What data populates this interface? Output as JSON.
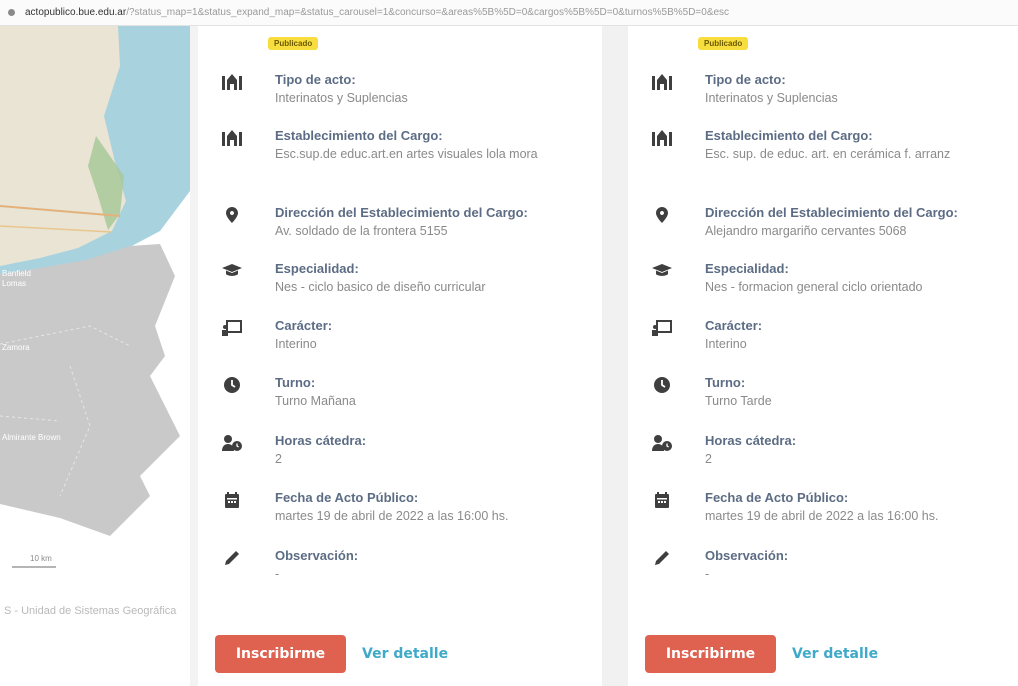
{
  "browser": {
    "url_domain": "actopublico.bue.edu.ar",
    "url_query": "/?status_map=1&status_expand_map=&status_carousel=1&concurso=&areas%5B%5D=0&cargos%5B%5D=0&turnos%5B%5D=0&esc"
  },
  "map": {
    "labels": [
      {
        "text": "Banfield"
      },
      {
        "text": "Lomas"
      },
      {
        "text": "Zamora"
      },
      {
        "text": "Almirante Brown"
      }
    ],
    "scale_label": "10 km",
    "attribution": "S - Unidad de Sistemas Geográfica"
  },
  "cards": [
    {
      "badge": "Publicado",
      "fields": [
        {
          "icon": "building-icon",
          "label": "Tipo de acto:",
          "value": "Interinatos y Suplencias"
        },
        {
          "icon": "building-icon",
          "label": "Establecimiento del Cargo:",
          "value": "Esc.sup.de educ.art.en artes visuales lola mora"
        },
        {
          "icon": "map-marker-icon",
          "label": "Dirección del Establecimiento del Cargo:",
          "value": "Av. soldado de la frontera 5155"
        },
        {
          "icon": "graduation-cap-icon",
          "label": "Especialidad:",
          "value": "Nes - ciclo basico de diseño curricular"
        },
        {
          "icon": "chalkboard-icon",
          "label": "Carácter:",
          "value": "Interino"
        },
        {
          "icon": "clock-icon",
          "label": "Turno:",
          "value": "Turno Mañana"
        },
        {
          "icon": "user-clock-icon",
          "label": "Horas cátedra:",
          "value": "2"
        },
        {
          "icon": "calendar-icon",
          "label": "Fecha de Acto Público:",
          "value": "martes 19 de abril de 2022 a las 16:00 hs."
        },
        {
          "icon": "pencil-icon",
          "label": "Observación:",
          "value": "-"
        }
      ],
      "primary_button": "Inscribirme",
      "secondary_button": "Ver detalle"
    },
    {
      "badge": "Publicado",
      "fields": [
        {
          "icon": "building-icon",
          "label": "Tipo de acto:",
          "value": "Interinatos y Suplencias"
        },
        {
          "icon": "building-icon",
          "label": "Establecimiento del Cargo:",
          "value": "Esc. sup. de educ. art. en cerámica f. arranz"
        },
        {
          "icon": "map-marker-icon",
          "label": "Dirección del Establecimiento del Cargo:",
          "value": "Alejandro margariño cervantes 5068"
        },
        {
          "icon": "graduation-cap-icon",
          "label": "Especialidad:",
          "value": "Nes - formacion general ciclo orientado"
        },
        {
          "icon": "chalkboard-icon",
          "label": "Carácter:",
          "value": "Interino"
        },
        {
          "icon": "clock-icon",
          "label": "Turno:",
          "value": "Turno Tarde"
        },
        {
          "icon": "user-clock-icon",
          "label": "Horas cátedra:",
          "value": "2"
        },
        {
          "icon": "calendar-icon",
          "label": "Fecha de Acto Público:",
          "value": "martes 19 de abril de 2022 a las 16:00 hs."
        },
        {
          "icon": "pencil-icon",
          "label": "Observación:",
          "value": "-"
        }
      ],
      "primary_button": "Inscribirme",
      "secondary_button": "Ver detalle"
    }
  ],
  "colors": {
    "label": "#5c6c84",
    "value": "#8a8a8a",
    "primary_button": "#df6250",
    "link": "#3fa9c9",
    "badge": "#f7dd3e",
    "icon": "#3f3f3f"
  }
}
